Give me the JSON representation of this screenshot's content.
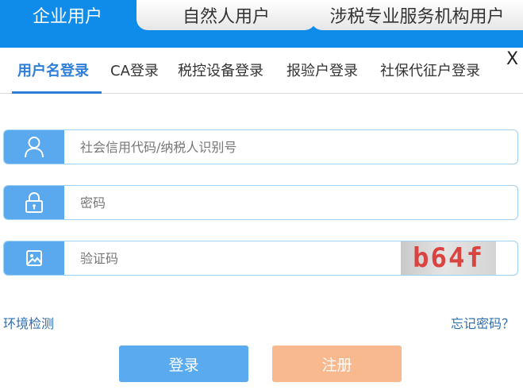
{
  "user_types": {
    "active": "企业用户",
    "natural_person": "自然人用户",
    "tax_agency": "涉税专业服务机构用户"
  },
  "close_label": "X",
  "login_methods": [
    "用户名登录",
    "CA登录",
    "税控设备登录",
    "报验户登录",
    "社保代征户登录"
  ],
  "form": {
    "username_placeholder": "社会信用代码/纳税人识别号",
    "password_placeholder": "密码",
    "captcha_placeholder": "验证码",
    "captcha_text": "b64f"
  },
  "links": {
    "env_check": "环境检测",
    "forgot_password": "忘记密码？"
  },
  "buttons": {
    "login": "登录",
    "register": "注册"
  },
  "colors": {
    "header_blue": "#0f8bea",
    "accent_blue": "#2f7fd8",
    "icon_blue": "#5aa9ee",
    "login_button": "#5aaaf0",
    "register_button": "#f8b98f",
    "captcha_red": "#d94440"
  },
  "icons": {
    "username": "user-icon",
    "password": "lock-icon",
    "captcha": "image-icon"
  }
}
